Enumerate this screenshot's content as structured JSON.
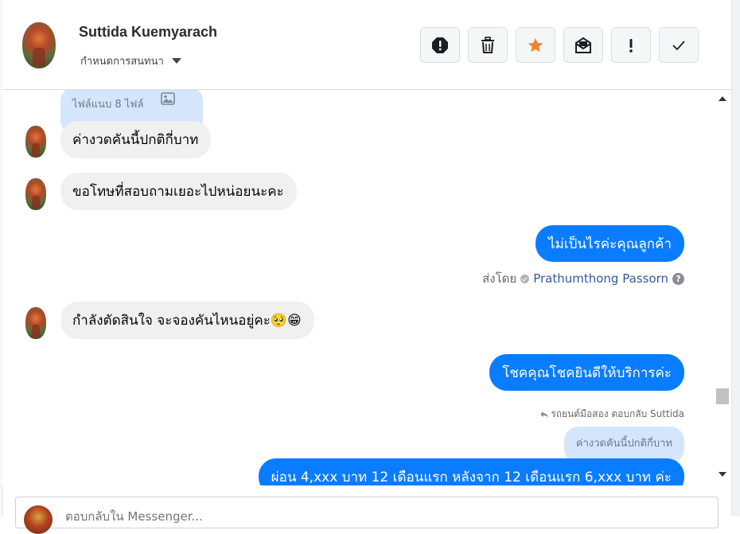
{
  "header": {
    "contact_name": "Suttida Kuemyarach",
    "assign_label": "กำหนดการสนทนา",
    "toolbar": [
      {
        "icon": "alert-octagon-icon",
        "action": "spam"
      },
      {
        "icon": "trash-icon",
        "action": "delete"
      },
      {
        "icon": "star-icon",
        "action": "follow-up",
        "color": "#f5832a"
      },
      {
        "icon": "mark-unread-icon",
        "action": "mark-unread"
      },
      {
        "icon": "exclamation-icon",
        "action": "important"
      },
      {
        "icon": "check-icon",
        "action": "done"
      }
    ]
  },
  "conversation": {
    "attachment_note": "ไฟล์แนบ 8 ไฟล์",
    "messages": [
      {
        "direction": "in",
        "text": "ค่างวดคันนี้ปกติกี่บาท"
      },
      {
        "direction": "in",
        "text": "ขอโทษที่สอบถามเยอะไปหน่อยนะคะ"
      },
      {
        "direction": "out",
        "text": "ไม่เป็นไรค่ะคุณลูกค้า"
      },
      {
        "direction": "in",
        "text": "กำลังตัดสินใจ จะจองคันไหนอยู่คะ🥺😁"
      },
      {
        "direction": "out",
        "text": "โชคคุณโชคยินดีให้บริการค่ะ"
      },
      {
        "direction": "out",
        "text": "ผ่อน 4,xxx บาท 12 เดือนแรก หลังจาก 12 เดือนแรก 6,xxx บาท ค่ะ"
      }
    ],
    "sent_by_label": "ส่งโดย",
    "sent_by_name": "Prathumthong Passorn",
    "reply_meta": "รถยนต์มือสอง ตอบกลับ Suttida",
    "quoted_text": "ค่างวดคันนี้ปกติกี่บาท"
  },
  "composer": {
    "placeholder": "ตอบกลับใน Messenger..."
  },
  "colors": {
    "outgoing_bubble": "#0a7cff",
    "incoming_bubble": "#f0f0f0",
    "quote_bubble": "#d5e5fb",
    "star": "#f5832a"
  }
}
